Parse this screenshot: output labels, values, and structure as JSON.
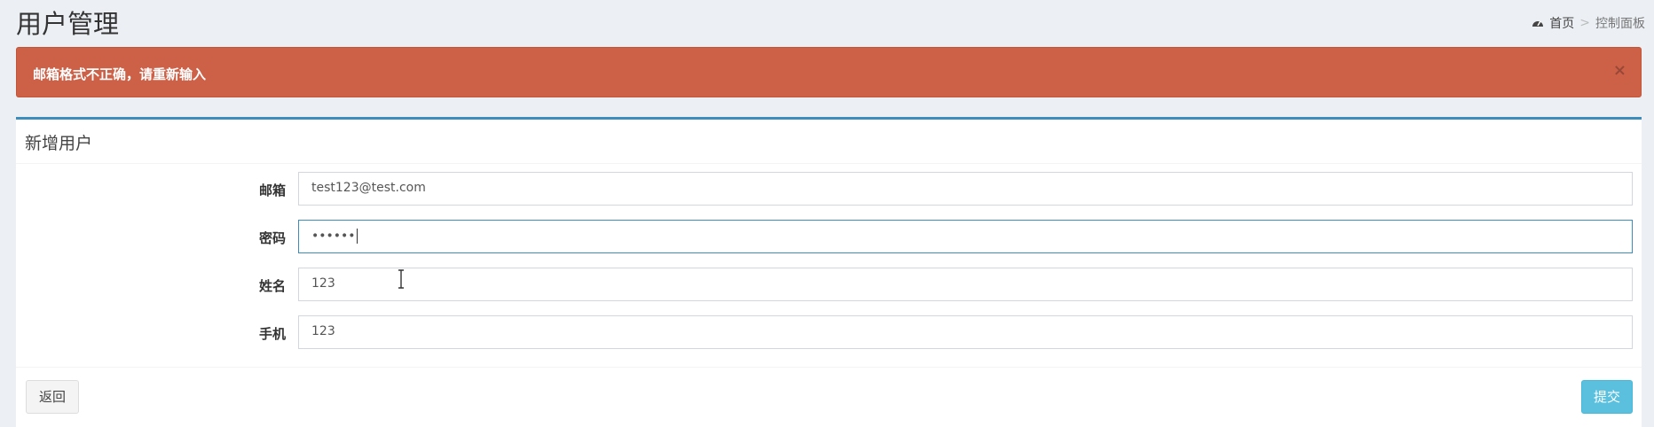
{
  "header": {
    "title": "用户管理"
  },
  "breadcrumb": {
    "home": "首页",
    "separator": ">",
    "current": "控制面板",
    "home_icon": "dashboard-icon"
  },
  "alert": {
    "message": "邮箱格式不正确，请重新输入",
    "close": "×",
    "color": "#cd6148"
  },
  "form": {
    "title": "新增用户",
    "fields": [
      {
        "label": "邮箱",
        "value": "test123@test.com"
      },
      {
        "label": "密码",
        "value": "••••••"
      },
      {
        "label": "姓名",
        "value": "123"
      },
      {
        "label": "手机",
        "value": "123"
      }
    ],
    "back_button": "返回",
    "submit_button": "提交"
  },
  "colors": {
    "accent": "#3c8dbc",
    "info": "#5bc0de"
  }
}
